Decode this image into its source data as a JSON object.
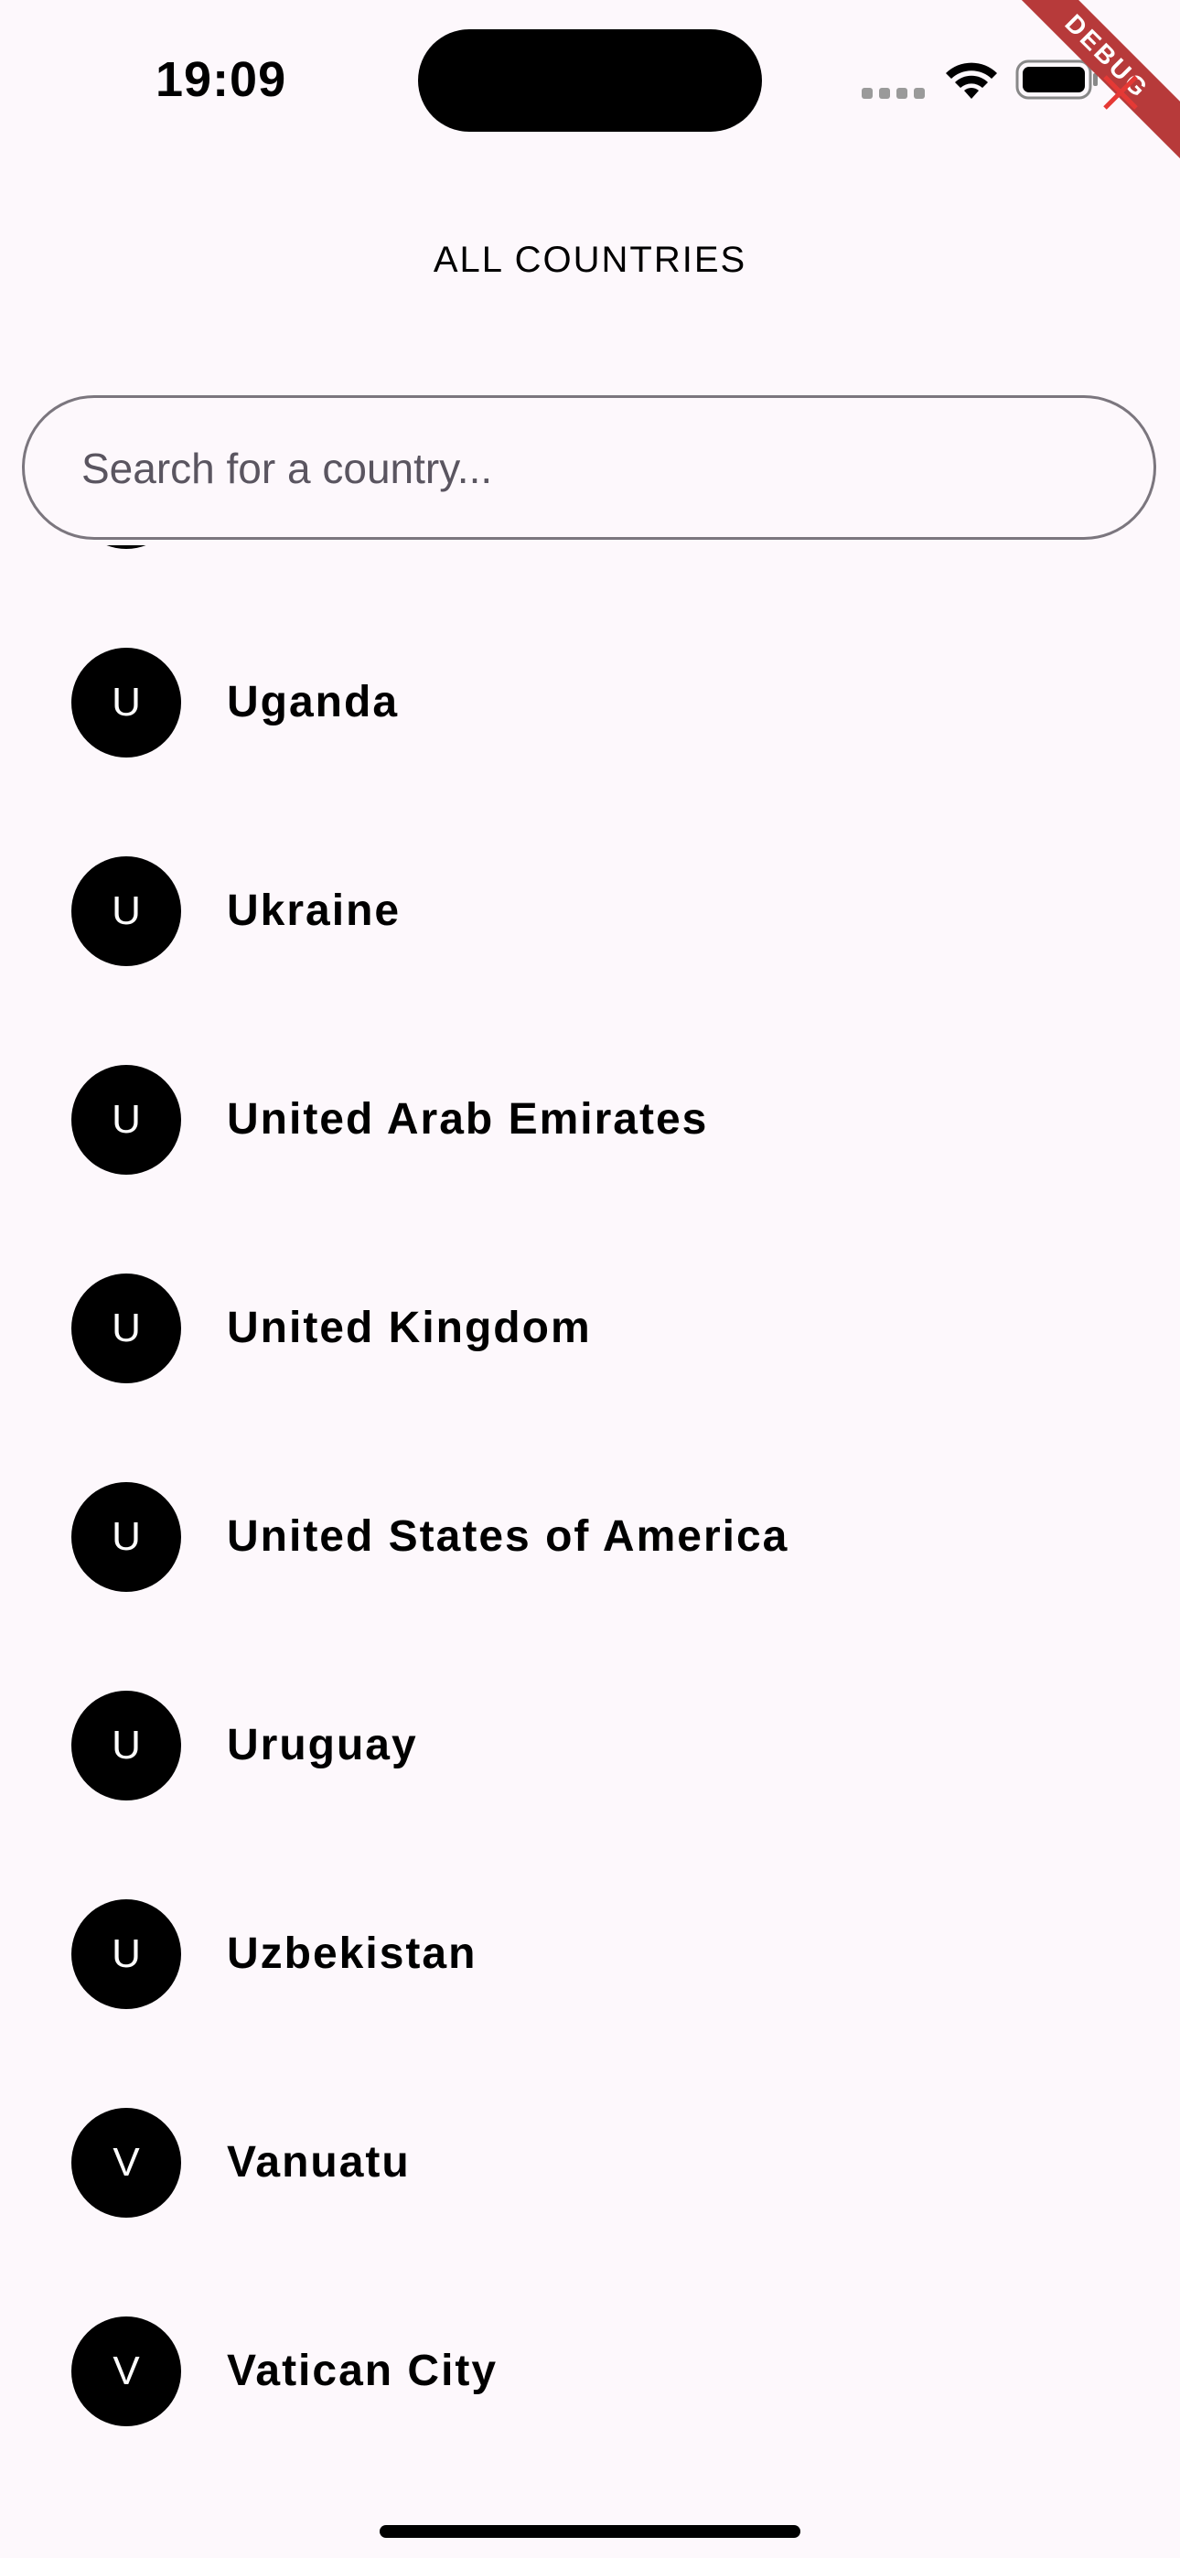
{
  "status_bar": {
    "time": "19:09"
  },
  "debug_banner": {
    "label": "DEBUG"
  },
  "header": {
    "title": "ALL COUNTRIES"
  },
  "search": {
    "placeholder": "Search for a country...",
    "value": ""
  },
  "countries": [
    {
      "initial": "",
      "name": ""
    },
    {
      "initial": "U",
      "name": "Uganda"
    },
    {
      "initial": "U",
      "name": "Ukraine"
    },
    {
      "initial": "U",
      "name": "United Arab Emirates"
    },
    {
      "initial": "U",
      "name": "United Kingdom"
    },
    {
      "initial": "U",
      "name": "United States of America"
    },
    {
      "initial": "U",
      "name": "Uruguay"
    },
    {
      "initial": "U",
      "name": "Uzbekistan"
    },
    {
      "initial": "V",
      "name": "Vanuatu"
    },
    {
      "initial": "V",
      "name": "Vatican City"
    }
  ],
  "icons": {
    "wifi": "wifi-icon",
    "battery": "battery-icon",
    "signal": "cellular-signal-icon",
    "close": "close-icon"
  },
  "colors": {
    "background": "#fdf8fc",
    "avatar": "#000000",
    "debug_ribbon": "#b73a3a",
    "search_border": "#7b767e"
  }
}
